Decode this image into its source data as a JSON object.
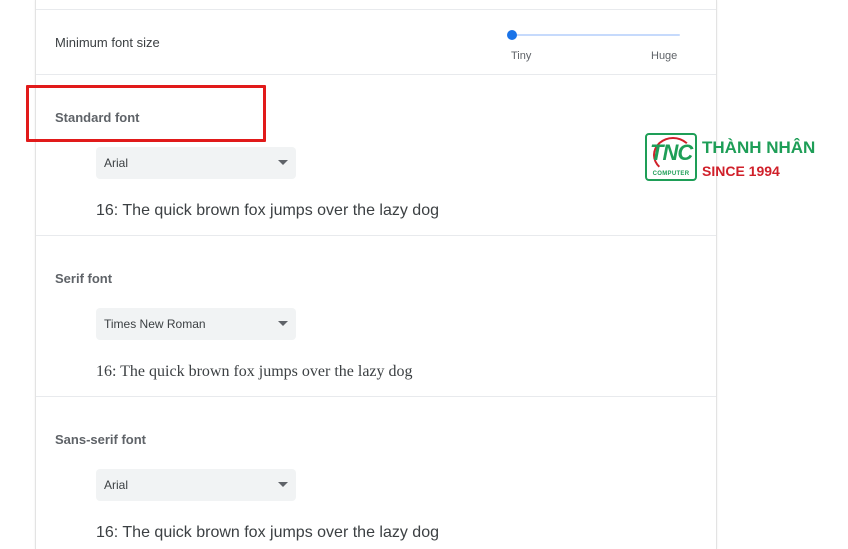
{
  "min_font_size": {
    "label": "Minimum font size",
    "slider_value_percent": 0,
    "min_label": "Tiny",
    "max_label": "Huge",
    "accent_color": "#1a73e8"
  },
  "standard_font": {
    "title": "Standard font",
    "selected": "Arial",
    "sample": "16: The quick brown fox jumps over the lazy dog"
  },
  "serif_font": {
    "title": "Serif font",
    "selected": "Times New Roman",
    "sample": "16: The quick brown fox jumps over the lazy dog"
  },
  "sans_serif_font": {
    "title": "Sans-serif font",
    "selected": "Arial",
    "sample": "16: The quick brown fox jumps over the lazy dog"
  },
  "logo": {
    "badge_text": "TNC",
    "badge_subtext": "COMPUTER",
    "name": "THÀNH NHÂN",
    "tagline": "SINCE 1994",
    "green": "#1e9e57",
    "red": "#d0202a"
  },
  "highlight_color": "#e11a1a"
}
